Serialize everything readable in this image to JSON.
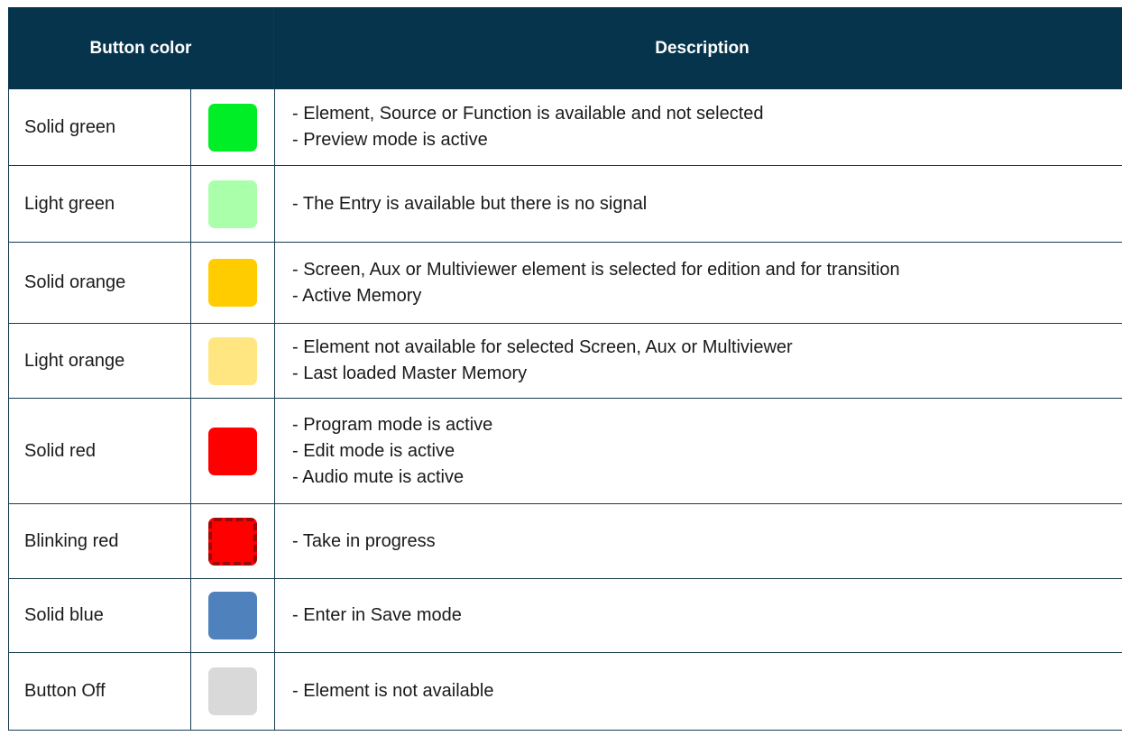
{
  "header": {
    "col_color": "Button color",
    "col_desc": "Description"
  },
  "rows": [
    {
      "name": "Solid green",
      "color": "#00ee26",
      "lines": [
        "- Element, Source or Function is available and not selected",
        "- Preview mode is active"
      ]
    },
    {
      "name": "Light green",
      "color": "#aaffaa",
      "lines": [
        "- The Entry is available but there is no signal"
      ]
    },
    {
      "name": "Solid orange",
      "color": "#ffcc00",
      "lines": [
        "- Screen, Aux or Multiviewer element is selected for edition and for transition",
        "- Active Memory"
      ]
    },
    {
      "name": "Light orange",
      "color": "#ffe680",
      "lines": [
        "- Element not available for selected Screen, Aux or Multiviewer",
        "- Last loaded Master Memory"
      ]
    },
    {
      "name": "Solid red",
      "color": "#ff0000",
      "lines": [
        "- Program mode is active",
        "- Edit mode is active",
        "- Audio mute is active"
      ]
    },
    {
      "name": "Blinking red",
      "color": "#ff0000",
      "style": "dashed-border",
      "lines": [
        "- Take in progress"
      ]
    },
    {
      "name": "Solid blue",
      "color": "#4f81bd",
      "lines": [
        "- Enter in Save mode"
      ]
    },
    {
      "name": "Button Off",
      "color": "#d9d9d9",
      "lines": [
        "- Element is not available"
      ]
    }
  ]
}
